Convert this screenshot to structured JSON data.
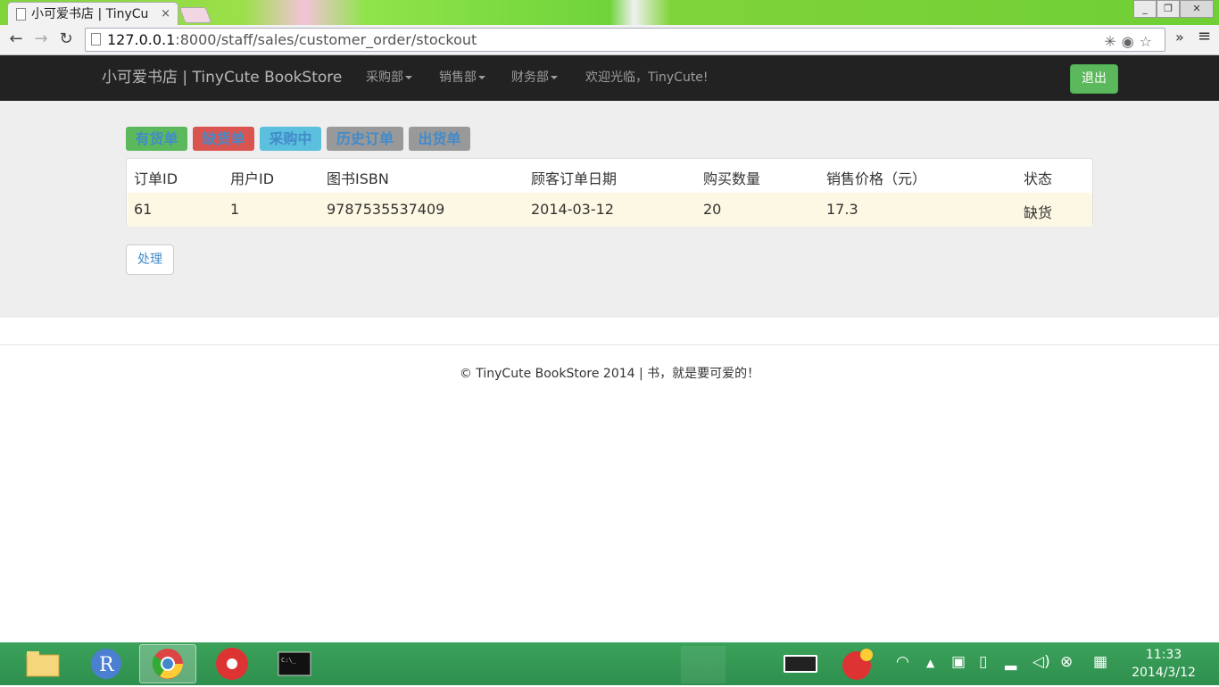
{
  "browser": {
    "tab_title": "小可爱书店 | TinyCu",
    "tab_close": "×",
    "url_host": "127.0.0.1",
    "url_rest": ":8000/staff/sales/customer_order/stockout",
    "more_label": "»",
    "menu_label": "≡"
  },
  "navbar": {
    "brand": "小可爱书店 | TinyCute BookStore",
    "menus": [
      "采购部",
      "销售部",
      "财务部"
    ],
    "welcome": "欢迎光临，TinyCute!",
    "logout": "退出"
  },
  "filters": [
    {
      "label": "有货单",
      "bg": "#5cb85c"
    },
    {
      "label": "缺货单",
      "bg": "#d9534f"
    },
    {
      "label": "采购中",
      "bg": "#5bc0de"
    },
    {
      "label": "历史订单",
      "bg": "#999999"
    },
    {
      "label": "出货单",
      "bg": "#999999"
    }
  ],
  "table": {
    "headers": [
      "订单ID",
      "用户ID",
      "图书ISBN",
      "顾客订单日期",
      "购买数量",
      "销售价格（元）",
      "状态"
    ],
    "rows": [
      [
        "61",
        "1",
        "9787535537409",
        "2014-03-12",
        "20",
        "17.3",
        "缺货"
      ]
    ]
  },
  "process_button": "处理",
  "footer": "© TinyCute BookStore 2014 | 书，就是要可爱的！",
  "taskbar": {
    "time": "11:33",
    "date": "2014/3/12"
  },
  "colors": {
    "link": "#428bca",
    "navbar_bg": "#222222",
    "main_bg": "#eeeeee",
    "warning_row": "#fcf8e3",
    "success": "#5cb85c"
  }
}
